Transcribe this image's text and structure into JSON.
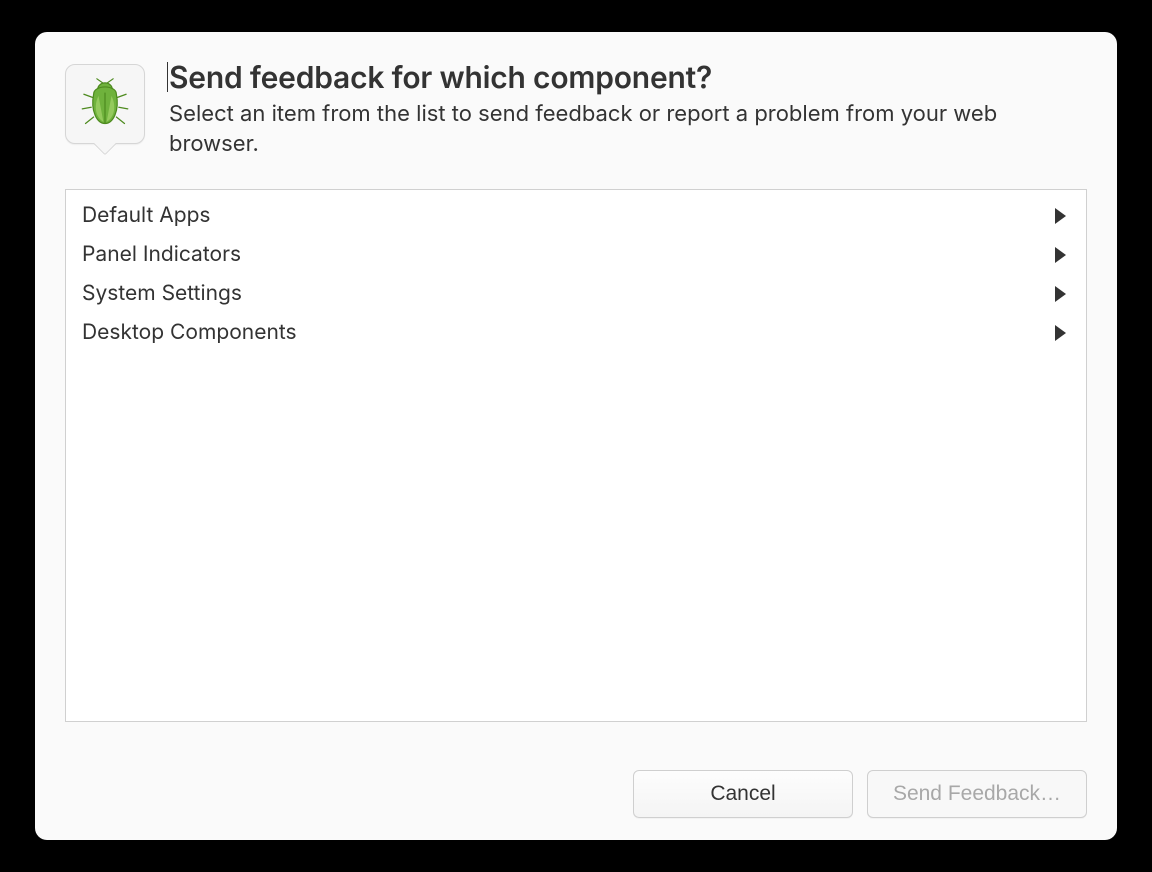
{
  "header": {
    "title": "Send feedback for which component?",
    "subtitle": "Select an item from the list to send feedback or report a problem from your web browser."
  },
  "icon": "bug-icon",
  "categories": [
    {
      "label": "Default Apps"
    },
    {
      "label": "Panel Indicators"
    },
    {
      "label": "System Settings"
    },
    {
      "label": "Desktop Components"
    }
  ],
  "buttons": {
    "cancel": "Cancel",
    "send": "Send Feedback…"
  }
}
